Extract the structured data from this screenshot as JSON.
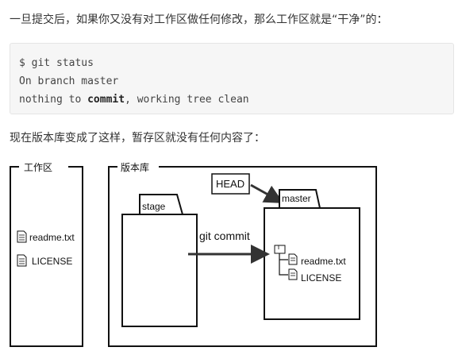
{
  "intro_text": "一旦提交后，如果你又没有对工作区做任何修改，那么工作区就是“干净”的：",
  "code": {
    "line1": "$ git status",
    "line2": "On branch master",
    "line3_prefix": "nothing to ",
    "line3_bold": "commit",
    "line3_suffix": ", working tree clean"
  },
  "after_text": "现在版本库变成了这样，暂存区就没有任何内容了：",
  "diagram": {
    "workspace_label": "工作区",
    "repo_label": "版本库",
    "workspace_files": [
      "readme.txt",
      "LICENSE"
    ],
    "head_label": "HEAD",
    "stage_label": "stage",
    "master_label": "master",
    "arrow_label": "git commit",
    "master_files": [
      "readme.txt",
      "LICENSE"
    ],
    "icons": [
      "file-icon",
      "folder-icon"
    ]
  }
}
